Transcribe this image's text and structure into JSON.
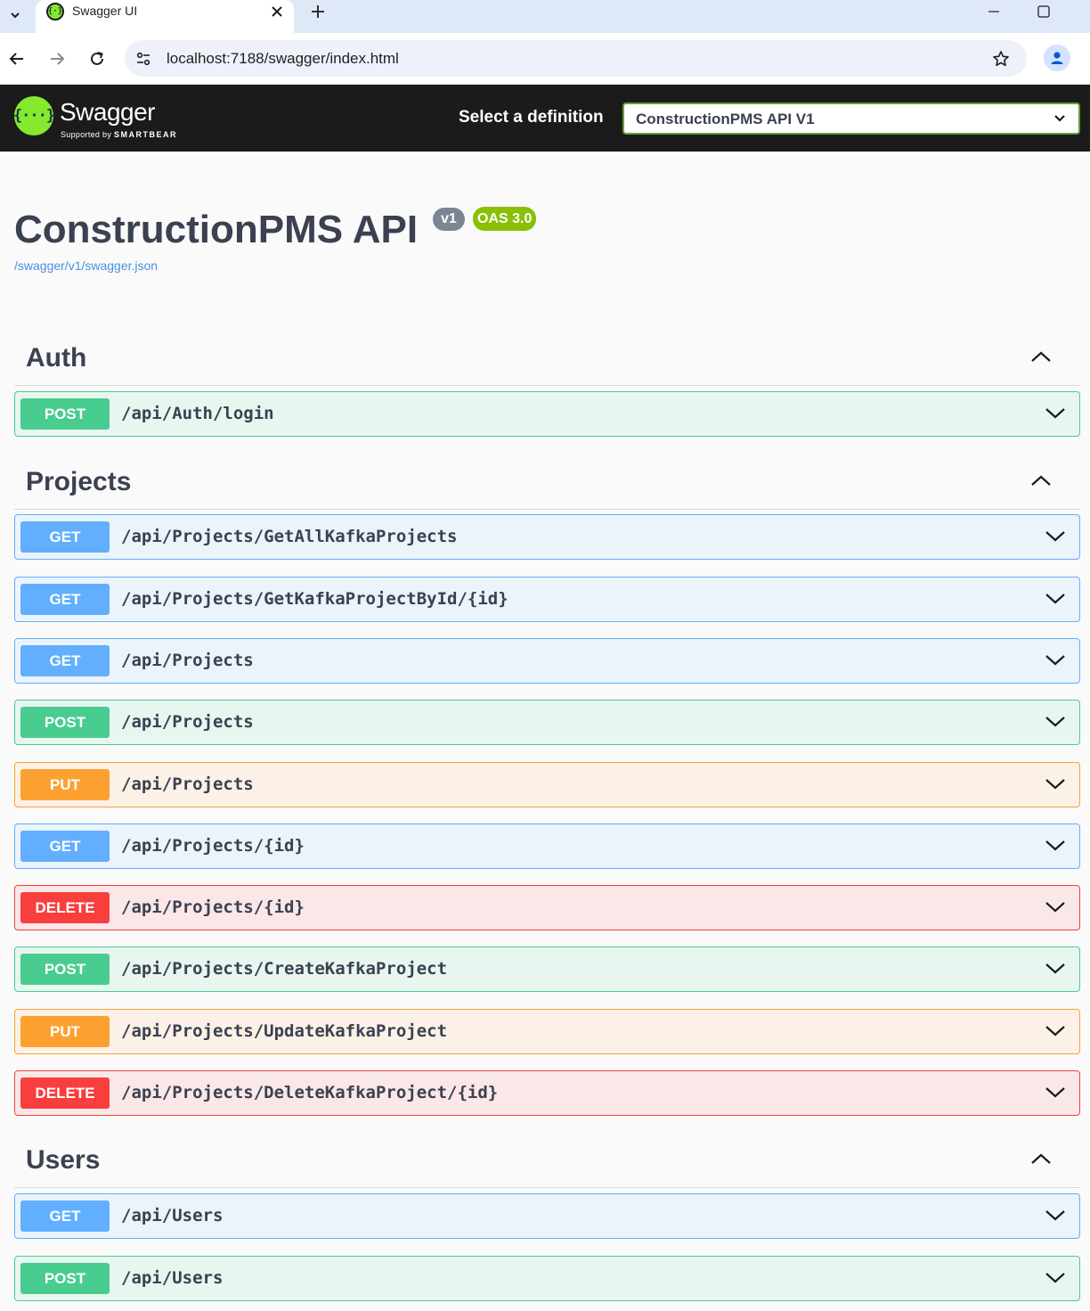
{
  "browser": {
    "tab_title": "Swagger UI",
    "url": "localhost:7188/swagger/index.html"
  },
  "topbar": {
    "logo_text": "Swagger",
    "logo_sub_prefix": "Supported by",
    "logo_sub_brand": "SMARTBEAR",
    "select_label": "Select a definition",
    "selected_definition": "ConstructionPMS API V1"
  },
  "info": {
    "title": "ConstructionPMS API",
    "version_badge": "v1",
    "oas_badge": "OAS 3.0",
    "spec_link": "/swagger/v1/swagger.json"
  },
  "tags": [
    {
      "name": "Auth",
      "operations": [
        {
          "method": "POST",
          "path": "/api/Auth/login"
        }
      ]
    },
    {
      "name": "Projects",
      "operations": [
        {
          "method": "GET",
          "path": "/api/Projects/GetAllKafkaProjects"
        },
        {
          "method": "GET",
          "path": "/api/Projects/GetKafkaProjectById/{id}"
        },
        {
          "method": "GET",
          "path": "/api/Projects"
        },
        {
          "method": "POST",
          "path": "/api/Projects"
        },
        {
          "method": "PUT",
          "path": "/api/Projects"
        },
        {
          "method": "GET",
          "path": "/api/Projects/{id}"
        },
        {
          "method": "DELETE",
          "path": "/api/Projects/{id}"
        },
        {
          "method": "POST",
          "path": "/api/Projects/CreateKafkaProject"
        },
        {
          "method": "PUT",
          "path": "/api/Projects/UpdateKafkaProject"
        },
        {
          "method": "DELETE",
          "path": "/api/Projects/DeleteKafkaProject/{id}"
        }
      ]
    },
    {
      "name": "Users",
      "operations": [
        {
          "method": "GET",
          "path": "/api/Users"
        },
        {
          "method": "POST",
          "path": "/api/Users"
        }
      ]
    }
  ],
  "colors": {
    "get": "#61affe",
    "post": "#49cc90",
    "put": "#fca130",
    "delete": "#f93e3e",
    "topbar_bg": "#1b1b1b",
    "logo_green": "#85ea2d",
    "link": "#4990e2"
  }
}
